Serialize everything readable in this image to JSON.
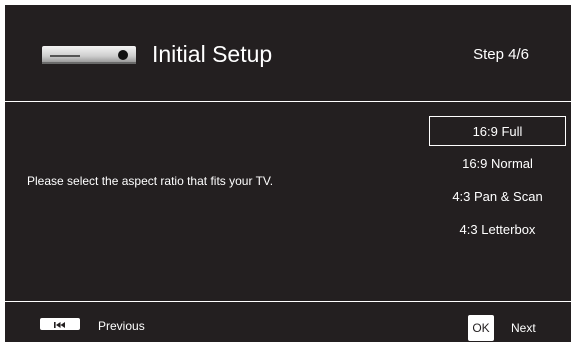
{
  "header": {
    "icon": "disc-player-icon",
    "title": "Initial Setup",
    "step": "Step 4/6"
  },
  "main": {
    "prompt": "Please select the aspect ratio that fits your TV.",
    "options": [
      {
        "label": "16:9 Full",
        "selected": true
      },
      {
        "label": "16:9 Normal",
        "selected": false
      },
      {
        "label": "4:3 Pan & Scan",
        "selected": false
      },
      {
        "label": "4:3 Letterbox",
        "selected": false
      }
    ]
  },
  "footer": {
    "previous_icon": "skip-previous-icon",
    "previous_label": "Previous",
    "ok_label": "OK",
    "next_label": "Next"
  },
  "colors": {
    "background": "#231f20",
    "text": "#ffffff"
  }
}
